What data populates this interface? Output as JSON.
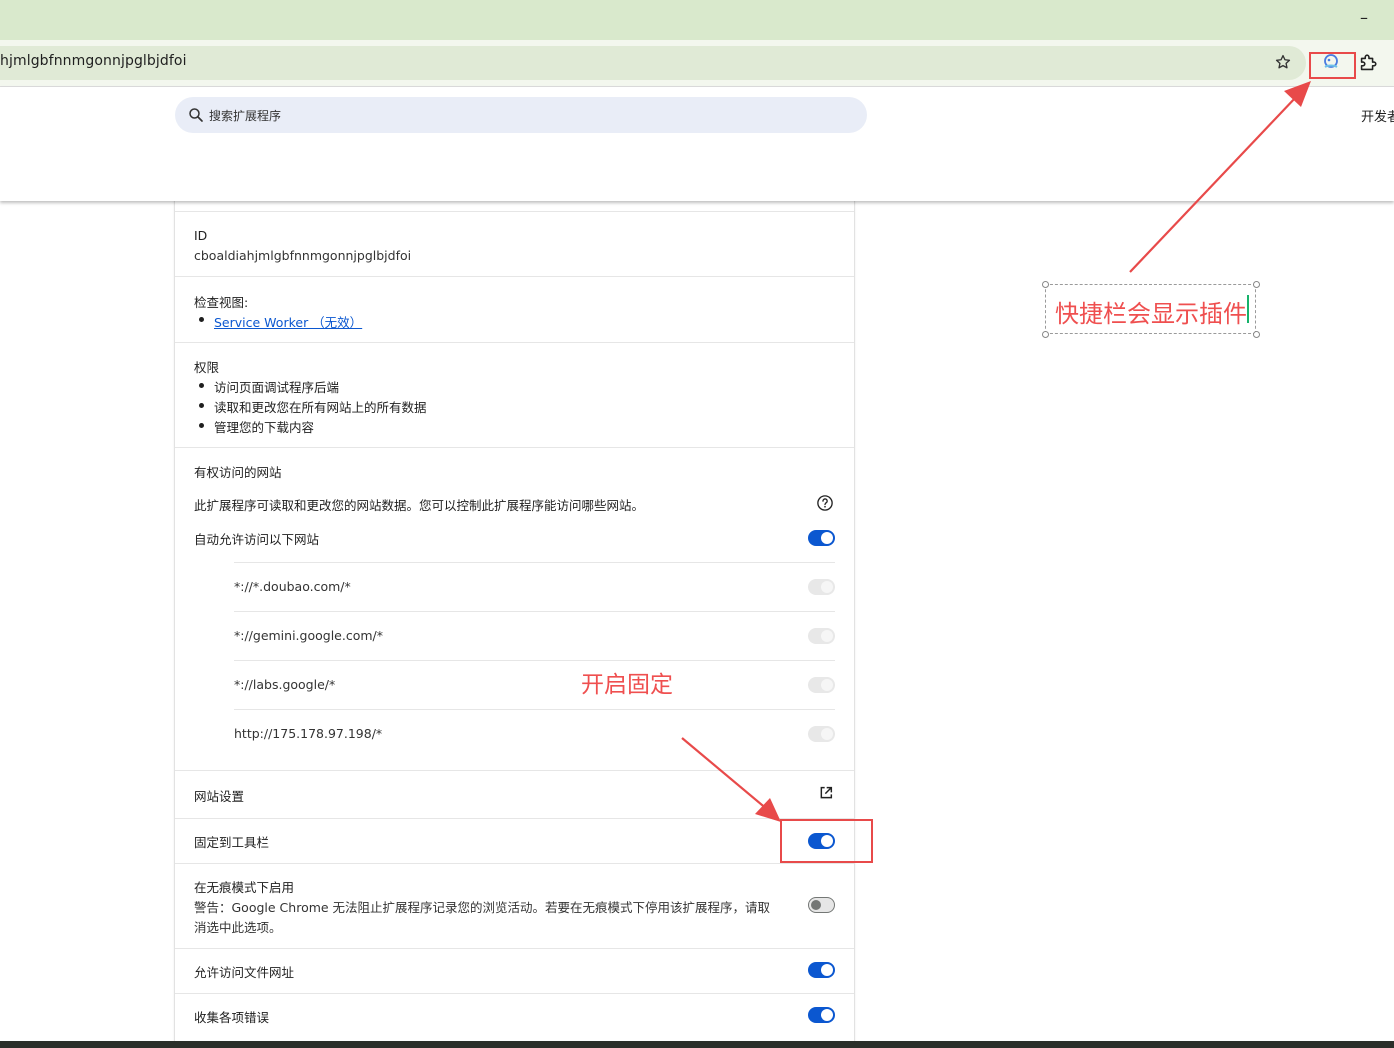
{
  "browser": {
    "url": "hjmlgbfnnmgonnjpglbjdfoi",
    "minimize_glyph": "–",
    "icons": [
      "star-icon",
      "extension-pinned-icon",
      "extensions-puzzle-icon"
    ]
  },
  "header": {
    "search_placeholder": "搜索扩展程序",
    "dev_mode_label": "开发者"
  },
  "details": {
    "id_label": "ID",
    "id_value": "cboaldiahjmlgbfnnmgonnjpglbjdfoi",
    "inspect_label": "检查视图:",
    "inspect_link": "Service Worker （无效）",
    "permissions_label": "权限",
    "permissions": [
      "访问页面调试程序后端",
      "读取和更改您在所有网站上的所有数据",
      "管理您的下载内容"
    ],
    "site_access_label": "有权访问的网站",
    "site_access_desc": "此扩展程序可读取和更改您的网站数据。您可以控制此扩展程序能访问哪些网站。",
    "auto_allow_label": "自动允许访问以下网站",
    "auto_allow_on": true,
    "sites": [
      "*://*.doubao.com/*",
      "*://gemini.google.com/*",
      "*://labs.google/*",
      "http://175.178.97.198/*"
    ],
    "site_settings_label": "网站设置",
    "pin_label": "固定到工具栏",
    "pin_on": true,
    "incognito_label": "在无痕模式下启用",
    "incognito_warning_1": "警告：Google Chrome 无法阻止扩展程序记录您的浏览活动。若要在无痕模式下停用该扩展程序，请取",
    "incognito_warning_2": "消选中此选项。",
    "incognito_on": false,
    "file_urls_label": "允许访问文件网址",
    "file_urls_on": true,
    "errors_label": "收集各项错误",
    "errors_on": true
  },
  "annotations": {
    "toolbar_note": "快捷栏会显示插件",
    "pin_note": "开启固定",
    "color": "#ef4f4f"
  },
  "colors": {
    "accent": "#0b57d0",
    "titlebar": "#d9e9cc"
  }
}
